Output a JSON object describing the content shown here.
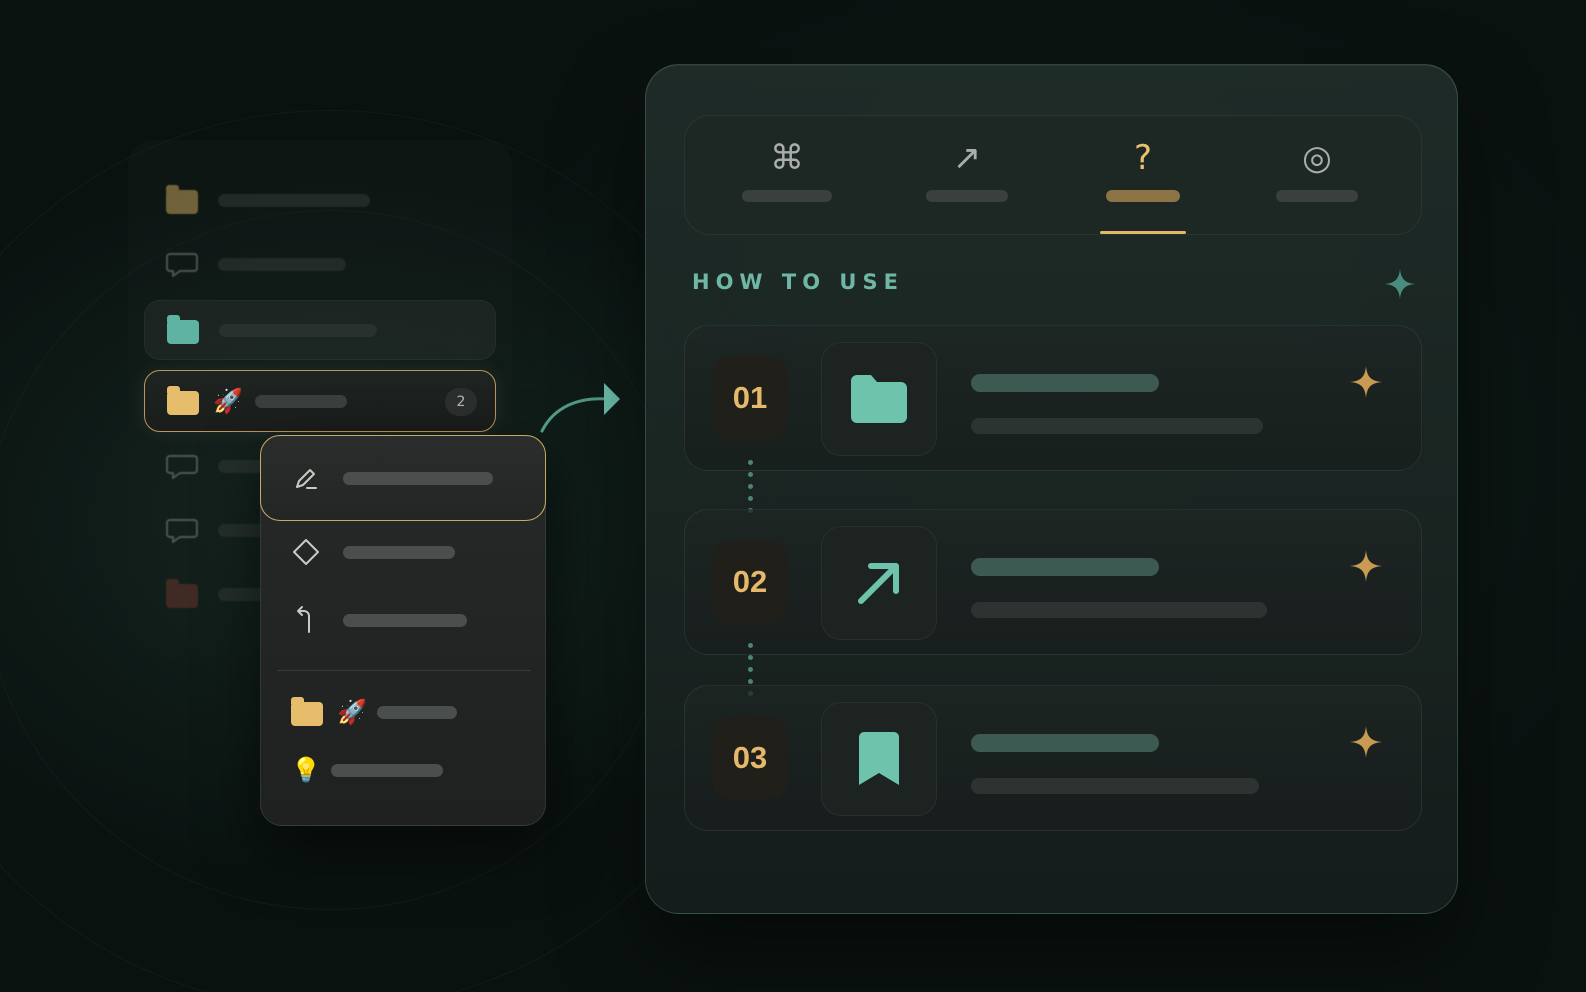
{
  "colors": {
    "accent_gold": "#e4ba6a",
    "accent_teal": "#6fb7a4",
    "background": "#0a1210"
  },
  "sidebar": {
    "items": [
      {
        "icon": "folder-icon",
        "color": "gold",
        "state": "faded"
      },
      {
        "icon": "chat-bubble-icon",
        "state": "faded"
      },
      {
        "icon": "folder-icon",
        "color": "teal",
        "state": "hover"
      },
      {
        "icon": "folder-icon",
        "color": "gold",
        "emoji": "🚀",
        "badge": "2",
        "state": "selected"
      },
      {
        "icon": "chat-bubble-icon",
        "state": "faded"
      },
      {
        "icon": "chat-bubble-icon",
        "state": "faded"
      },
      {
        "icon": "folder-icon",
        "color": "brown",
        "state": "faded"
      }
    ],
    "selected_badge": "2",
    "selected_emoji": "🚀"
  },
  "context_menu": {
    "items": [
      {
        "icon": "pencil-icon",
        "state": "highlighted"
      },
      {
        "icon": "diamond-icon"
      },
      {
        "icon": "undo-arrow-icon"
      },
      {
        "icon": "folder-icon",
        "emoji": "🚀"
      },
      {
        "icon": "lightbulb-icon",
        "emoji": "💡"
      }
    ],
    "rocket_emoji": "🚀",
    "bulb_emoji": "💡"
  },
  "tabs": {
    "items": [
      {
        "glyph": "⌘",
        "icon": "command-icon"
      },
      {
        "glyph": "↗",
        "icon": "arrow-up-right-icon"
      },
      {
        "glyph": "?",
        "icon": "question-icon",
        "active": true
      },
      {
        "glyph": "◎",
        "icon": "target-icon"
      }
    ],
    "active_index": 2
  },
  "section": {
    "title": "HOW TO USE"
  },
  "steps": [
    {
      "number": "01",
      "icon": "folder-icon"
    },
    {
      "number": "02",
      "icon": "arrow-up-right-icon"
    },
    {
      "number": "03",
      "icon": "bookmark-icon"
    }
  ]
}
